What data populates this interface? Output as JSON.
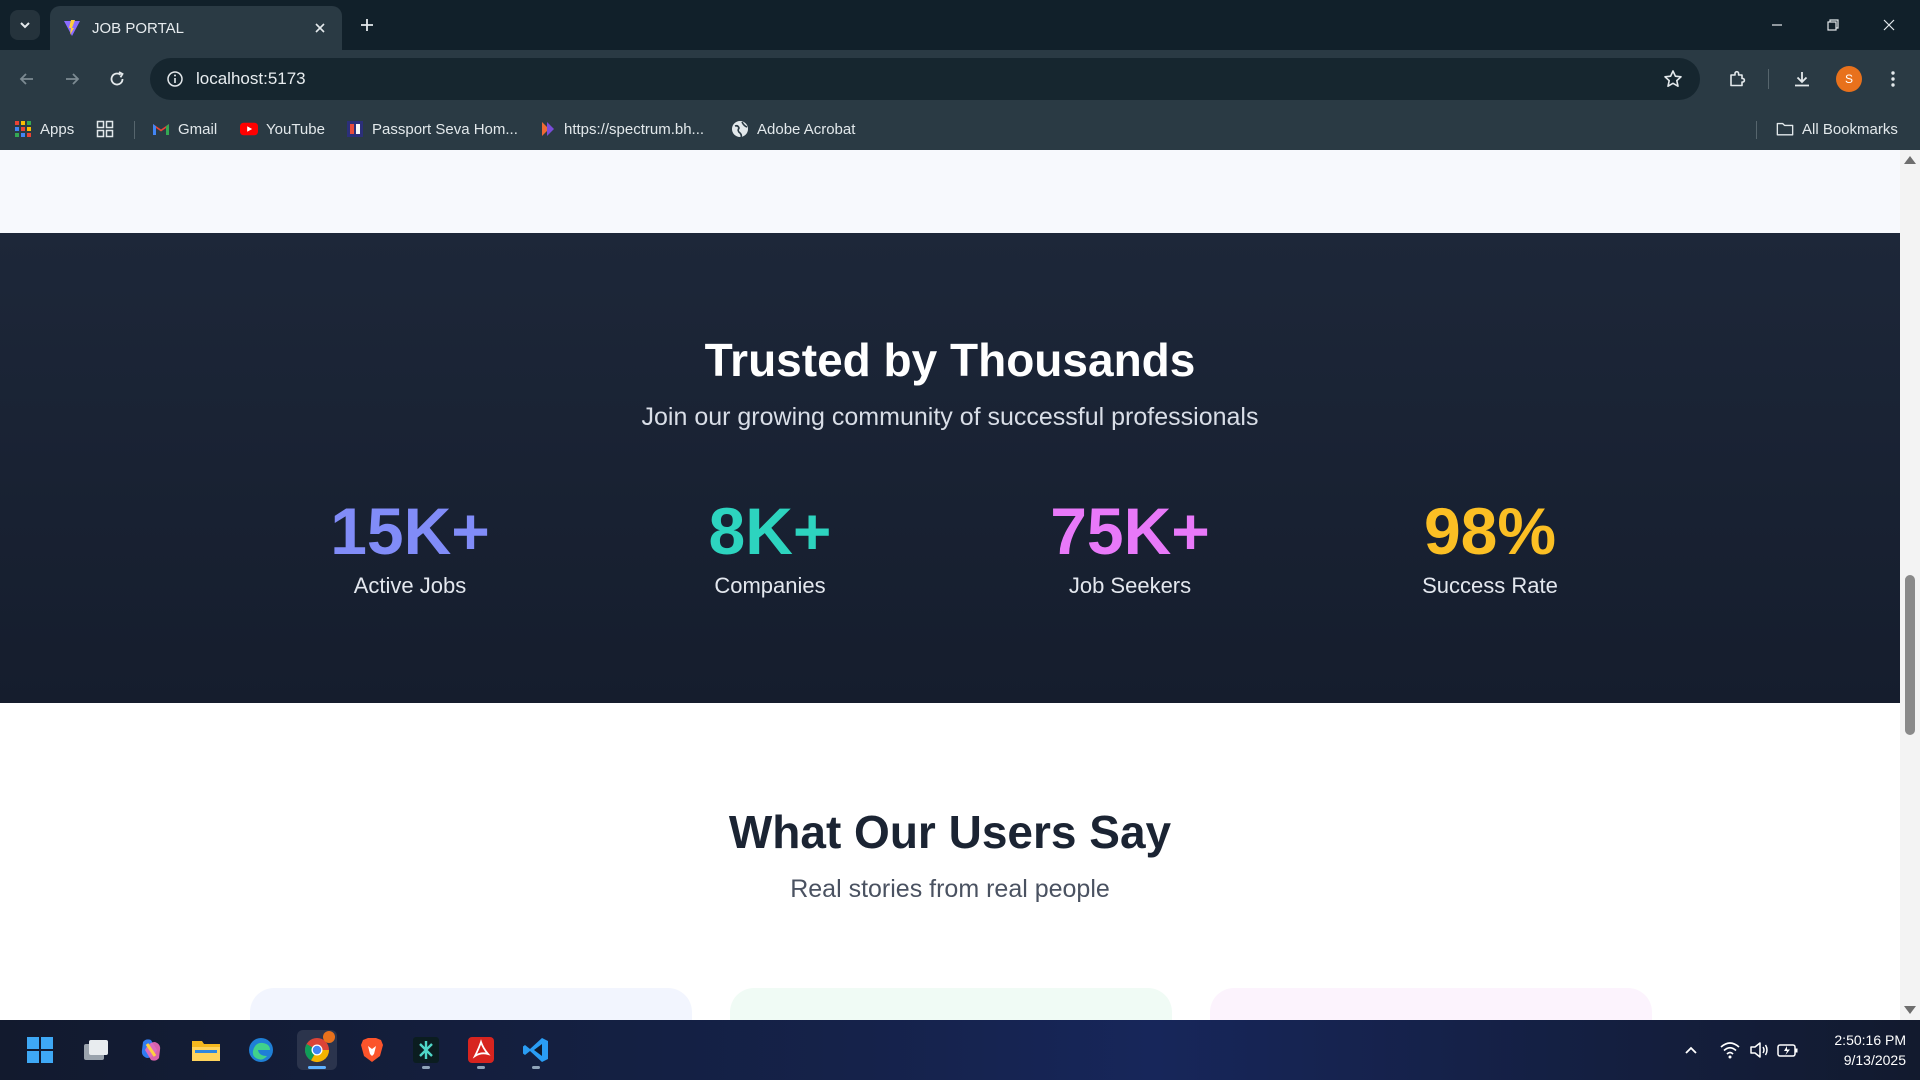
{
  "browser": {
    "tab_title": "JOB PORTAL",
    "url": "localhost:5173",
    "bookmarks": [
      {
        "label": "Apps",
        "icon": "apps-grid-icon"
      },
      {
        "label": "Gmail",
        "icon": "gmail-icon"
      },
      {
        "label": "YouTube",
        "icon": "youtube-icon"
      },
      {
        "label": "Passport Seva Hom...",
        "icon": "passport-seva-icon"
      },
      {
        "label": "https://spectrum.bh...",
        "icon": "spectrum-icon"
      },
      {
        "label": "Adobe Acrobat",
        "icon": "globe-icon"
      }
    ],
    "all_bookmarks": "All Bookmarks",
    "profile_initial": "S"
  },
  "page": {
    "stats": {
      "title": "Trusted by Thousands",
      "subtitle": "Join our growing community of successful professionals",
      "items": [
        {
          "value": "15K+",
          "label": "Active Jobs",
          "color": "#818cf8"
        },
        {
          "value": "8K+",
          "label": "Companies",
          "color": "#2dd4bf"
        },
        {
          "value": "75K+",
          "label": "Job Seekers",
          "color": "#e879f9"
        },
        {
          "value": "98%",
          "label": "Success Rate",
          "color": "#fbbf24"
        }
      ]
    },
    "testimonials": {
      "title": "What Our Users Say",
      "subtitle": "Real stories from real people"
    }
  },
  "taskbar": {
    "apps": [
      "start-icon",
      "task-view-icon",
      "copilot-icon",
      "file-explorer-icon",
      "edge-icon",
      "chrome-icon",
      "brave-icon",
      "app-icon",
      "acrobat-icon",
      "vscode-icon"
    ],
    "time": "2:50:16 PM",
    "date": "9/13/2025"
  }
}
